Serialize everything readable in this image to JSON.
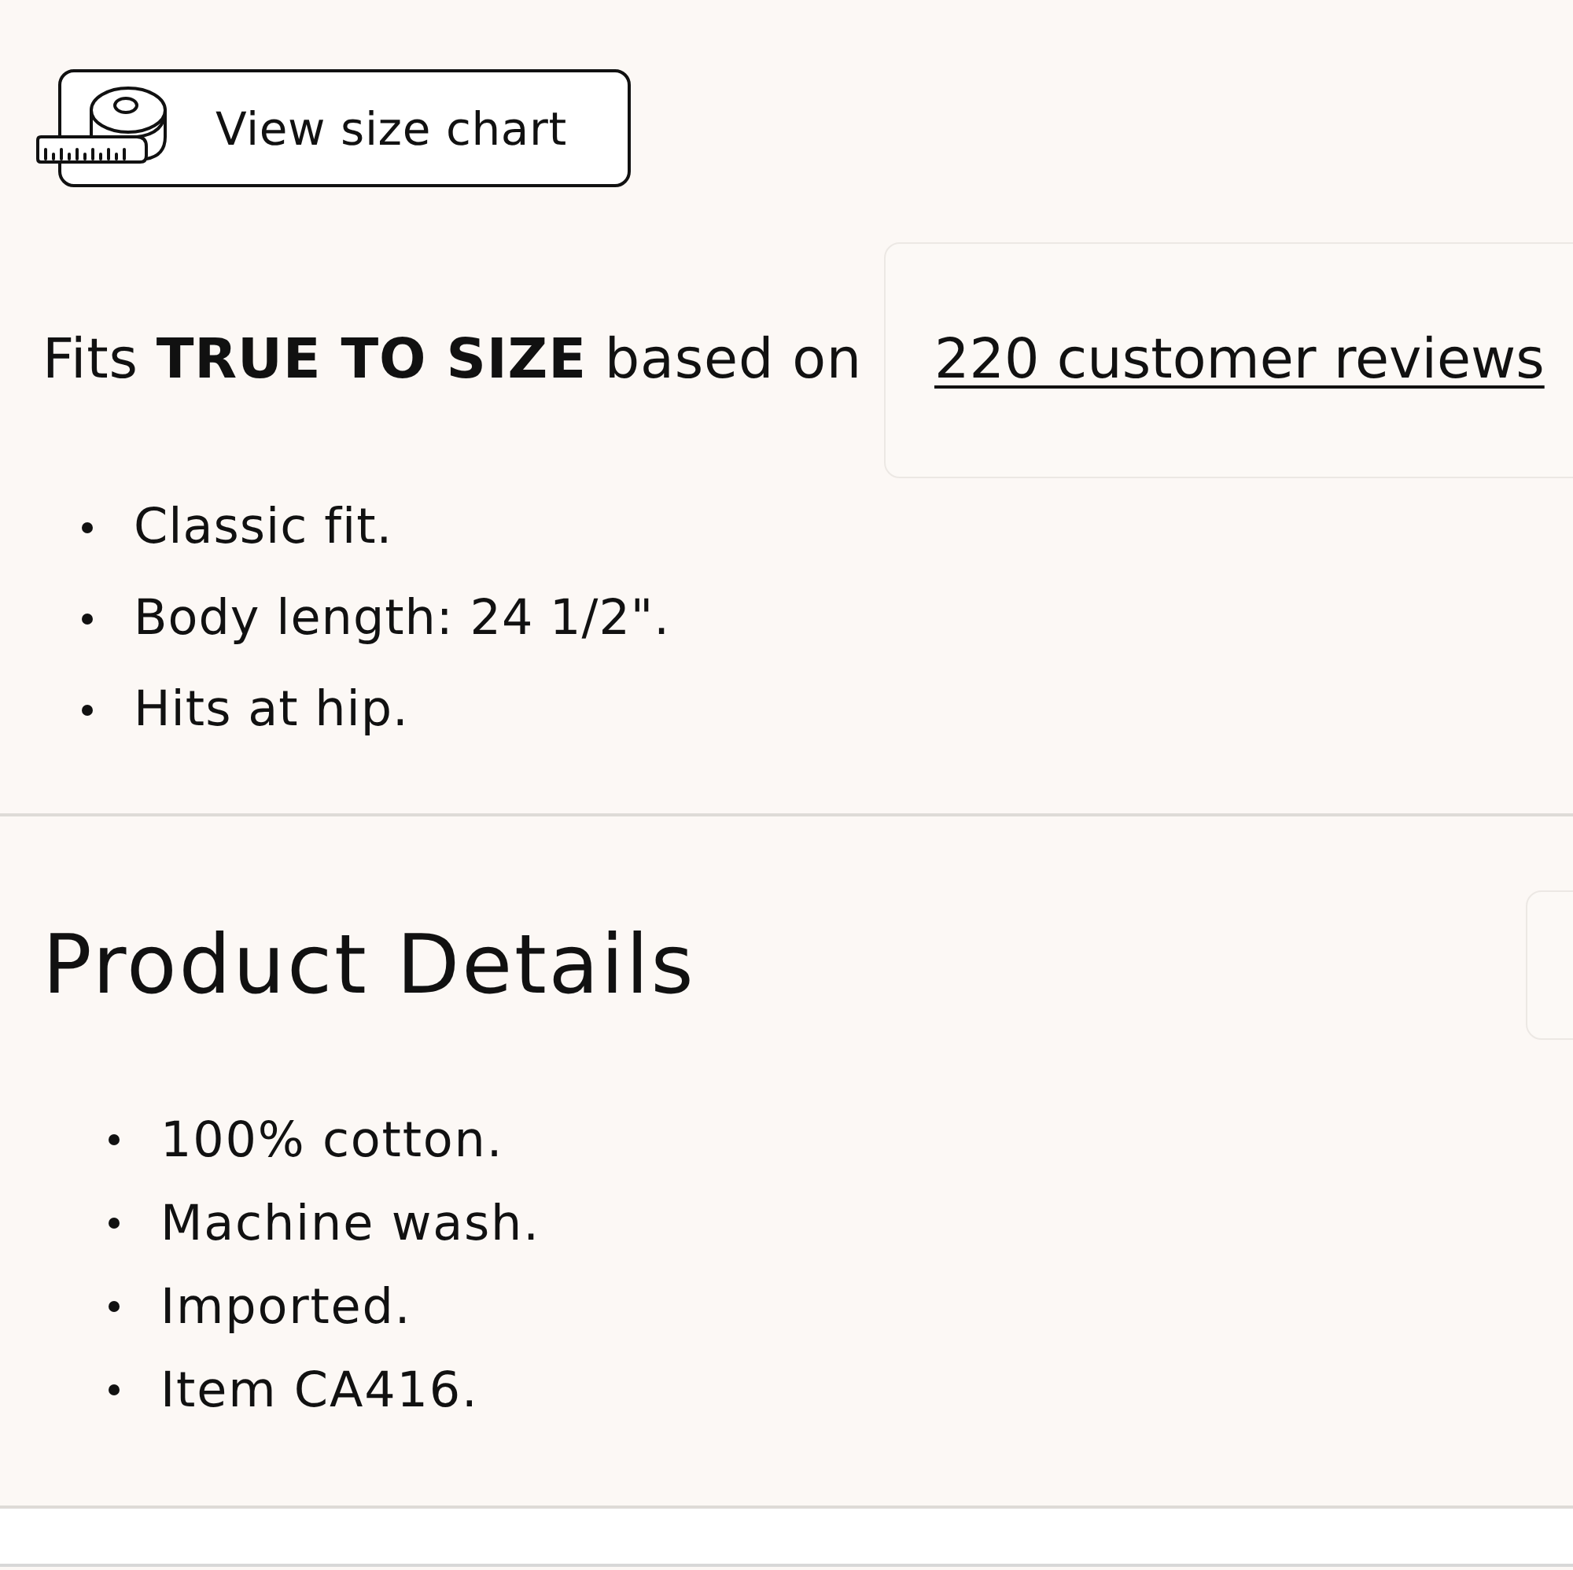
{
  "size_chart_button": {
    "label": "View size chart"
  },
  "fit": {
    "text": "Fits **TRUE TO SIZE** based on",
    "reviews_link": "220 customer reviews"
  },
  "fit_notes": [
    "Classic fit.",
    "Body length: 24 1/2\".",
    "Hits at hip."
  ],
  "product_details": {
    "title": "Product Details",
    "items": [
      "100% cotton.",
      "Machine wash.",
      "Imported.",
      "Item CA416."
    ]
  }
}
